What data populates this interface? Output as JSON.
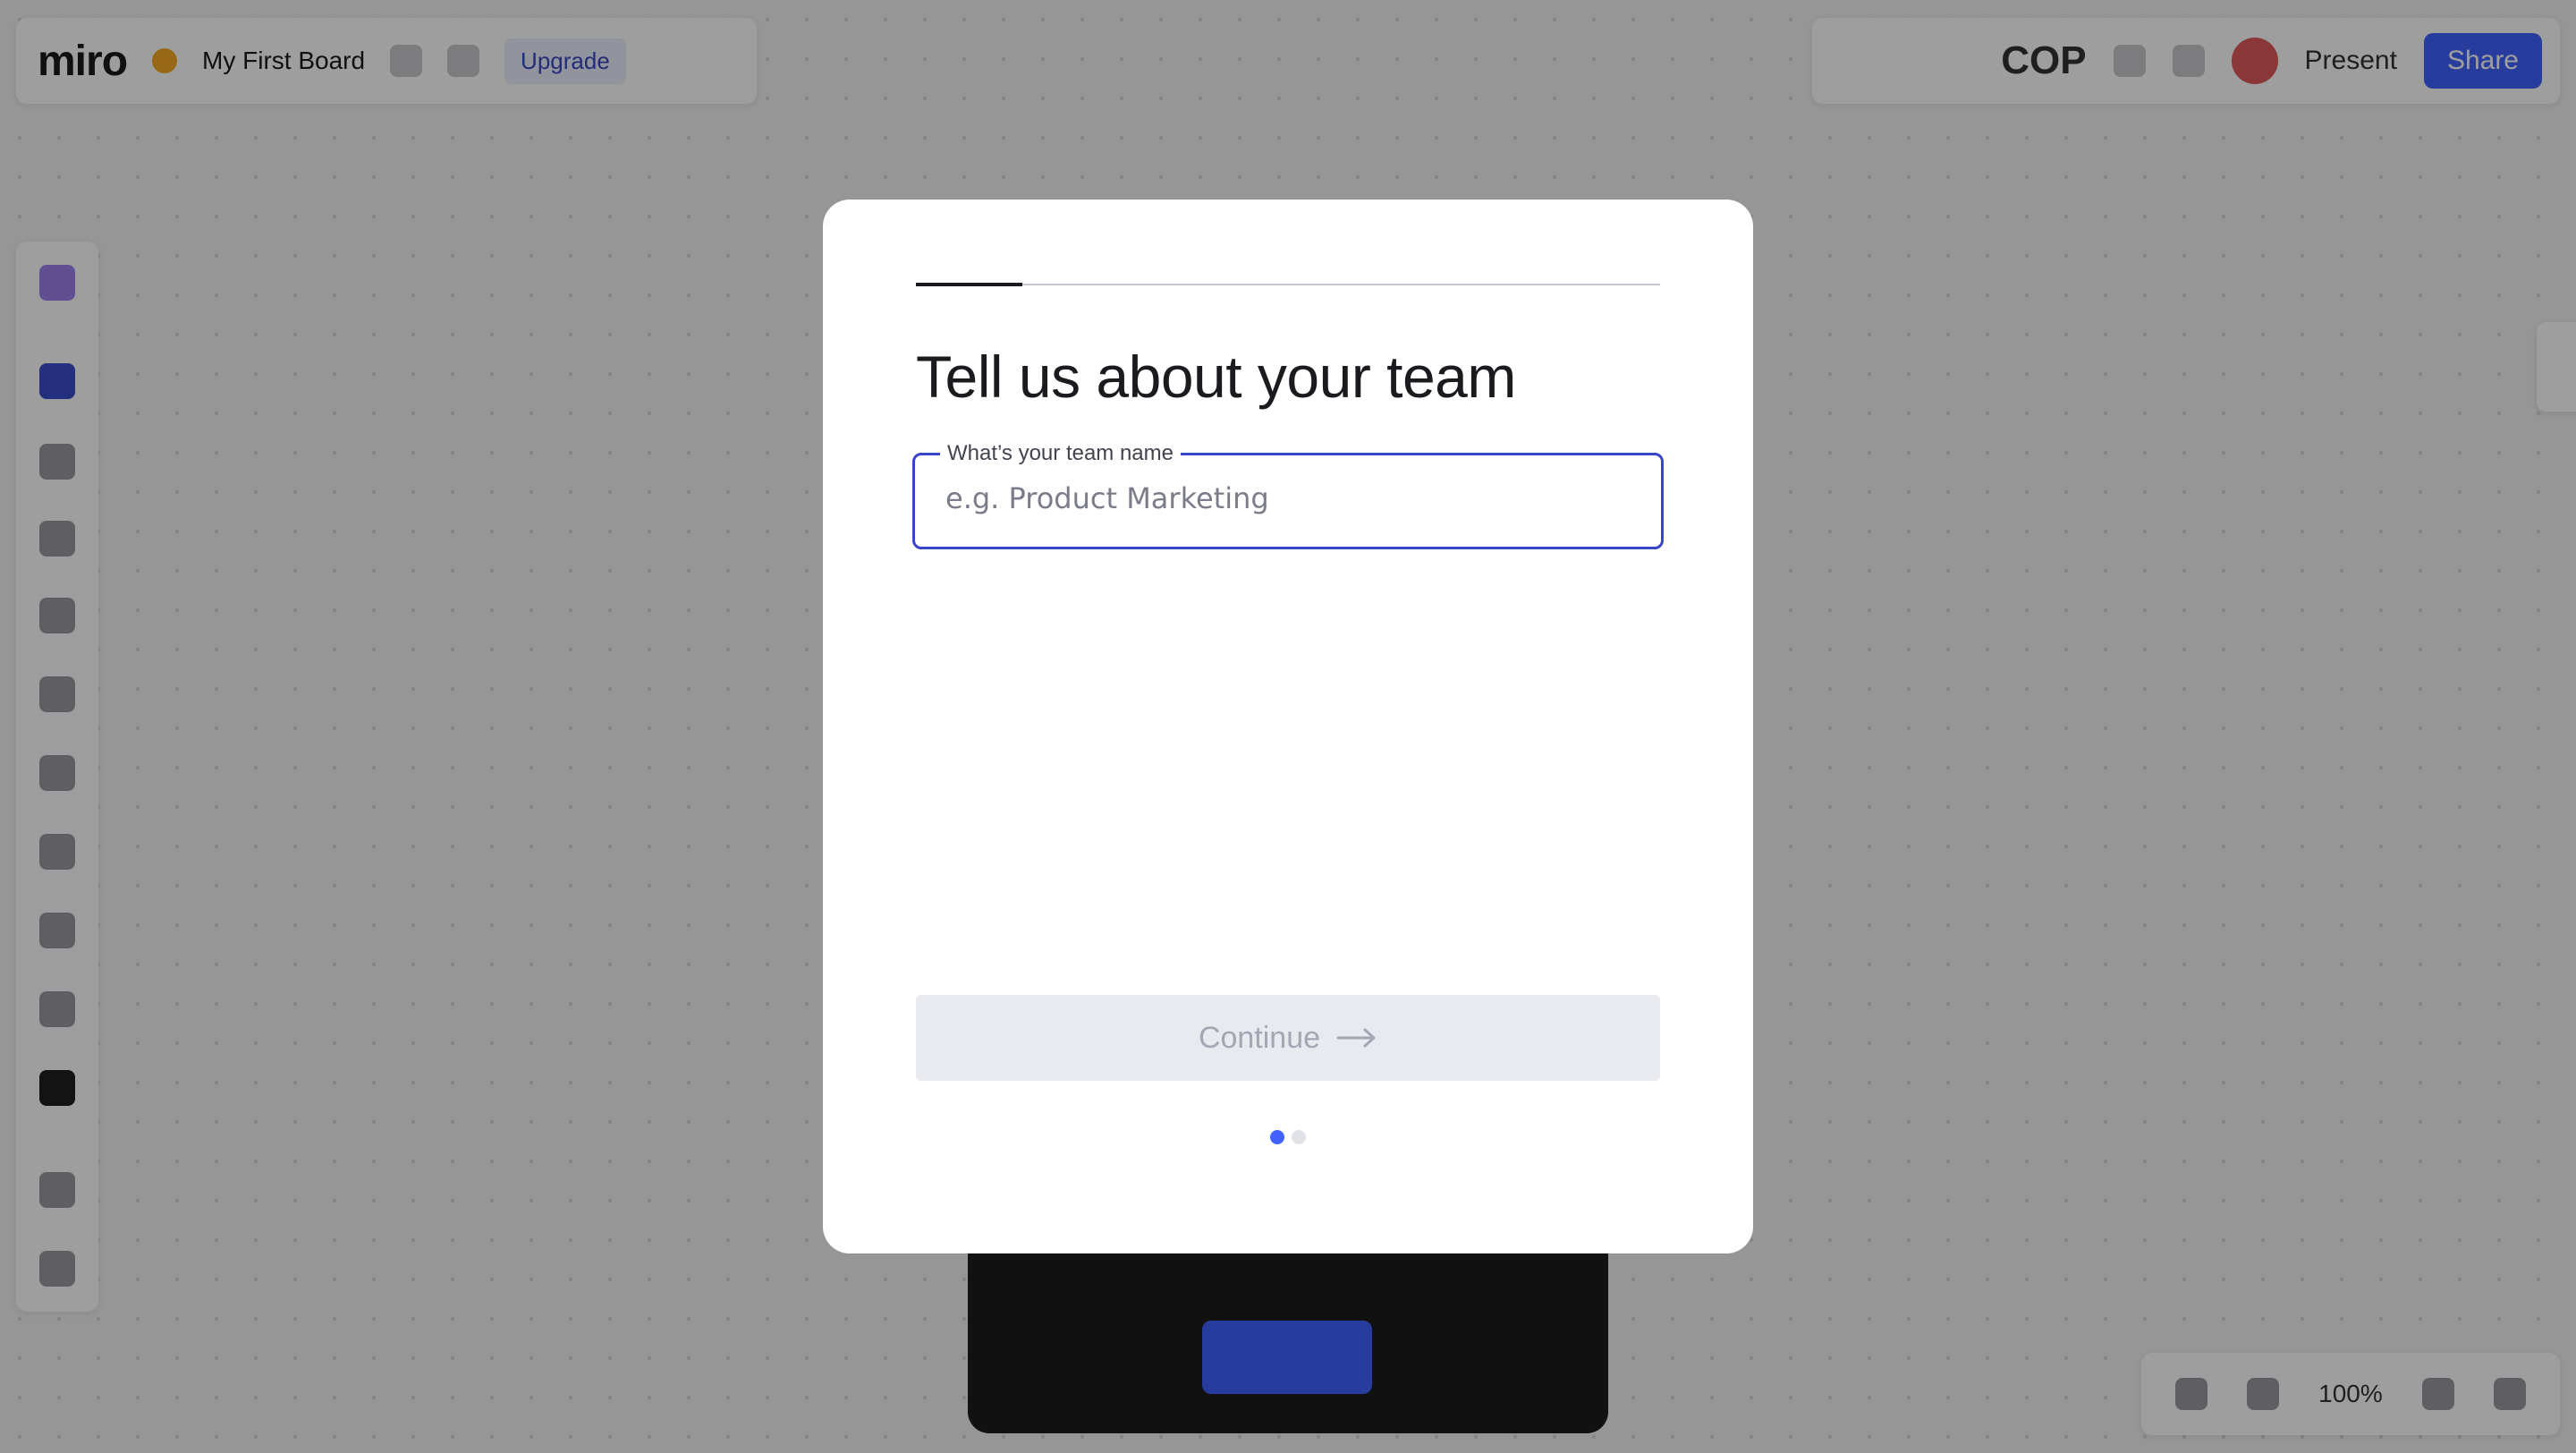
{
  "app": {
    "logo": "miro",
    "board_title": "My First Board",
    "upgrade_label": "Upgrade",
    "timer": "COP",
    "present_label": "Present",
    "share_label": "Share",
    "zoom_level": "100%"
  },
  "modal": {
    "progress_fraction": 0.143,
    "title": "Tell us about your team",
    "team_field": {
      "label": "What’s your team name",
      "placeholder": "e.g. Product Marketing",
      "value": ""
    },
    "continue_label": "Continue",
    "steps_total": 2,
    "step_current": 1
  },
  "colors": {
    "accent": "#4262ff",
    "focus_border": "#3845c9",
    "overlay": "rgba(0,0,0,0.38)"
  }
}
